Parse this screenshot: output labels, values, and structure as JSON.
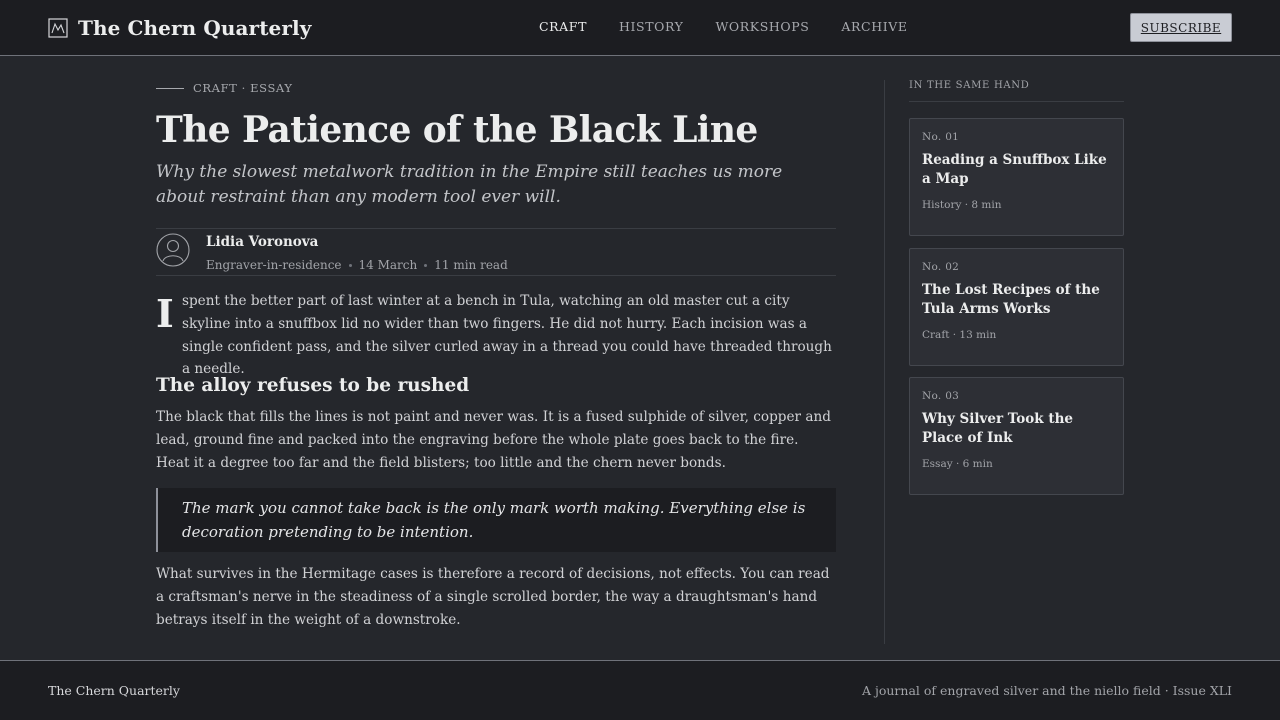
{
  "header": {
    "brand_title": "The Chern Quarterly",
    "brand_icon": "mountain-frame-icon",
    "nav": [
      {
        "label": "CRAFT",
        "active": true
      },
      {
        "label": "HISTORY",
        "active": false
      },
      {
        "label": "WORKSHOPS",
        "active": false
      },
      {
        "label": "ARCHIVE",
        "active": false
      }
    ],
    "subscribe_label": "SUBSCRIBE"
  },
  "article": {
    "kicker": "CRAFT · ESSAY",
    "headline": "The Patience of the Black Line",
    "dek": "Why the slowest metalwork tradition in the Empire still teaches us more about restraint than any modern tool ever will.",
    "author": {
      "name": "Lidia Voronova",
      "role": "Engraver-in-residence",
      "date": "14 March",
      "read_time": "11 min read",
      "avatar_icon": "user-avatar-icon"
    },
    "dropcap": "I",
    "lede": "spent the better part of last winter at a bench in Tula, watching an old master cut a city skyline into a snuffbox lid no wider than two fingers. He did not hurry. Each incision was a single confident pass, and the silver curled away in a thread you could have threaded through a needle.",
    "section_heading": "The alloy refuses to be rushed",
    "paragraph_1": "The black that fills the lines is not paint and never was. It is a fused sulphide of silver, copper and lead, ground fine and packed into the engraving before the whole plate goes back to the fire. Heat it a degree too far and the field blisters; too little and the chern never bonds.",
    "pullquote": "The mark you cannot take back is the only mark worth making. Everything else is decoration pretending to be intention.",
    "paragraph_2": "What survives in the Hermitage cases is therefore a record of decisions, not effects. You can read a craftsman's nerve in the steadiness of a single scrolled border, the way a draughtsman's hand betrays itself in the weight of a downstroke."
  },
  "sidebar": {
    "heading": "IN THE SAME HAND",
    "cards": [
      {
        "number": "No. 01",
        "title": "Reading a Snuffbox Like a Map",
        "meta": "History · 8 min"
      },
      {
        "number": "No. 02",
        "title": "The Lost Recipes of the Tula Arms Works",
        "meta": "Craft · 13 min"
      },
      {
        "number": "No. 03",
        "title": "Why Silver Took the Place of Ink",
        "meta": "Essay · 6 min"
      }
    ]
  },
  "footer": {
    "brand": "The Chern Quarterly",
    "tagline": "A journal of engraved silver and the niello field · Issue XLI"
  },
  "colors": {
    "background": "#25272c",
    "header_background": "#1c1d21",
    "text_primary": "#eceded",
    "text_muted": "#a2a4a9",
    "button_background": "#c9ccd4",
    "card_background": "#2d2f35"
  }
}
